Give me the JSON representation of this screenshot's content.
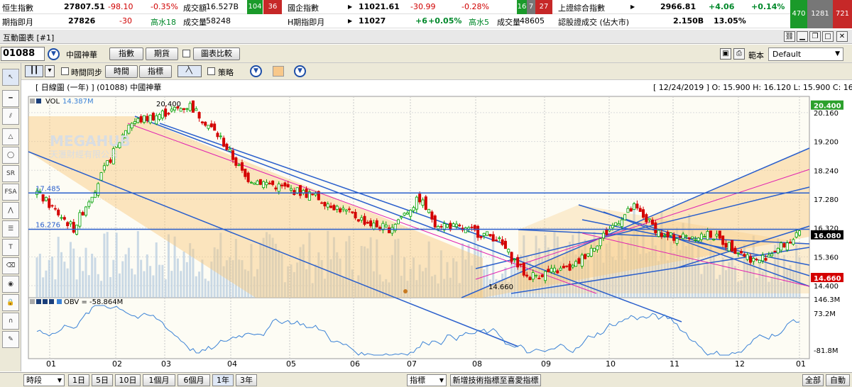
{
  "ticker": {
    "row1": [
      {
        "label": "恒生指數",
        "value": "27807.51",
        "change": "-98.10",
        "pct": "-0.35%",
        "turnover_label": "成交額",
        "turnover": "16.527B",
        "up": "104",
        "down": "36"
      },
      {
        "label": "國企指數",
        "value": "11021.61",
        "change": "-30.99",
        "pct": "-0.28%",
        "up": "16",
        "flat": "7",
        "down": "27"
      },
      {
        "label": "上證綜合指數",
        "value": "2966.81",
        "change": "+4.06",
        "pct": "+0.14%"
      }
    ],
    "row2": [
      {
        "label": "期指即月",
        "value": "27826",
        "change": "-30",
        "premium": "高水18",
        "volume_label": "成交量",
        "volume": "58248"
      },
      {
        "label": "H期指即月",
        "value": "11027",
        "change": "+6",
        "pct": "+0.05%",
        "premium": "高水5",
        "volume_label": "成交量",
        "volume": "48605"
      },
      {
        "label": "認股證成交 (佔大市)",
        "value": "2.150B",
        "pct": "13.05%"
      }
    ],
    "breadth": {
      "up": "470",
      "flat": "1281",
      "down": "721"
    }
  },
  "window": {
    "title": "互動圖表 [#1]"
  },
  "toolbar": {
    "code": "01088",
    "name": "中國神華",
    "btn_index": "指數",
    "btn_futures": "期貨",
    "btn_compare": "圖表比較",
    "template_label": "範本",
    "template_value": "Default",
    "sync_label": "時間同步",
    "btn_time": "時間",
    "btn_indicator": "指標",
    "strategy_label": "策略"
  },
  "chart": {
    "header": "[ 日線圖 (一年) ]  (01088)  中國神華",
    "ohlc": "[ 12/24/2019 ]  O: 15.900  H: 16.120  L: 15.900  C: 16.080",
    "vol_label": "VOL",
    "vol_value": "14.387M",
    "obv_label": "OBV = -58.864M",
    "watermark": "MEGAHUB",
    "watermark_sub": "天滙財經有限公司",
    "price_labels": [
      "20.160",
      "19.200",
      "18.240",
      "17.280",
      "16.320",
      "15.360",
      "14.400"
    ],
    "current_price": "16.080",
    "high_price": "20.400",
    "low_price": "14.660",
    "obv_labels": [
      "146.3M",
      "73.2M",
      "-81.8M"
    ],
    "hline_labels": [
      "17.485",
      "16.276"
    ],
    "annot_high": "20.400",
    "annot_low": "14.660",
    "months": [
      "01",
      "02",
      "03",
      "04",
      "05",
      "06",
      "07",
      "08",
      "09",
      "10",
      "11",
      "12",
      "01"
    ],
    "colors": {
      "up": "#00a000",
      "down": "#d40000",
      "channel": "#2a5fcc",
      "mid": "#e020b0",
      "fill": "#f8c87a",
      "obv": "#3b82d6",
      "volume": "#b8cde0"
    }
  },
  "bottom": {
    "period": "時段",
    "ranges": [
      "1日",
      "5日",
      "10日",
      "1個月",
      "6個月",
      "1年",
      "3年"
    ],
    "indicator_select": "指標",
    "notice": "新增技術指標至喜愛指標",
    "btn_all": "全部",
    "btn_auto": "自動"
  },
  "tools": [
    "pointer-icon",
    "line-icon",
    "channel-icon",
    "triangle-icon",
    "ellipse-icon",
    "speed-resistance-icon",
    "fan-icon",
    "fibonacci-icon",
    "text-icon",
    "eraser-icon",
    "eye-icon",
    "lock-icon",
    "magnet-icon"
  ]
}
